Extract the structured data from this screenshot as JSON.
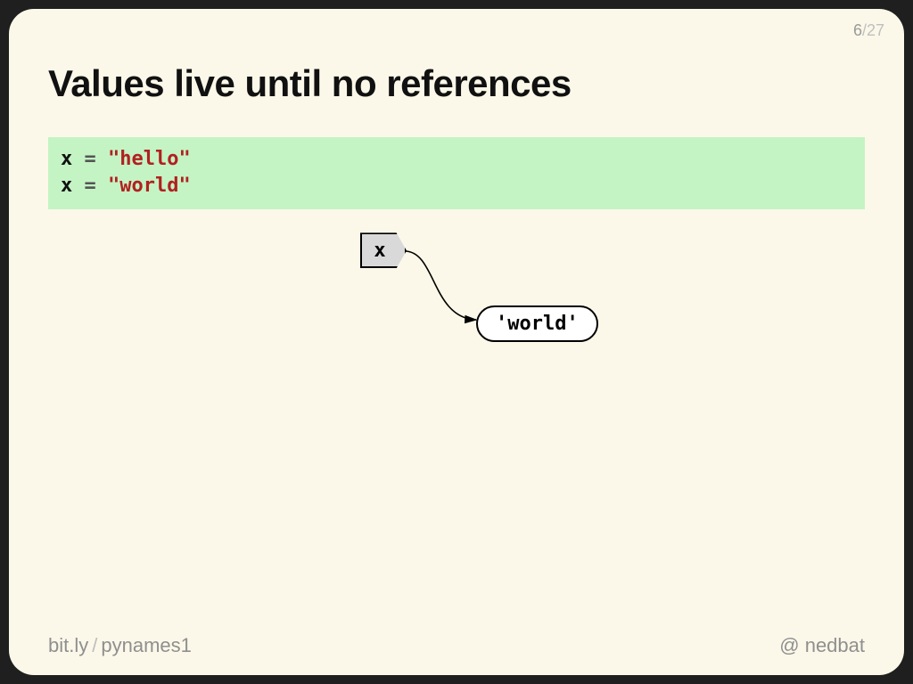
{
  "pager": {
    "current": "6",
    "sep": "/",
    "total": "27"
  },
  "title": "Values live until no references",
  "code": {
    "lines": [
      {
        "var": "x",
        "op": "=",
        "str": "\"hello\""
      },
      {
        "var": "x",
        "op": "=",
        "str": "\"world\""
      }
    ]
  },
  "diagram": {
    "var_label": "x",
    "value_label": "'world'"
  },
  "footer": {
    "link_host": "bit.ly",
    "link_sep": "/",
    "link_path": "pynames1",
    "handle_prefix": "@",
    "handle": "nedbat"
  }
}
